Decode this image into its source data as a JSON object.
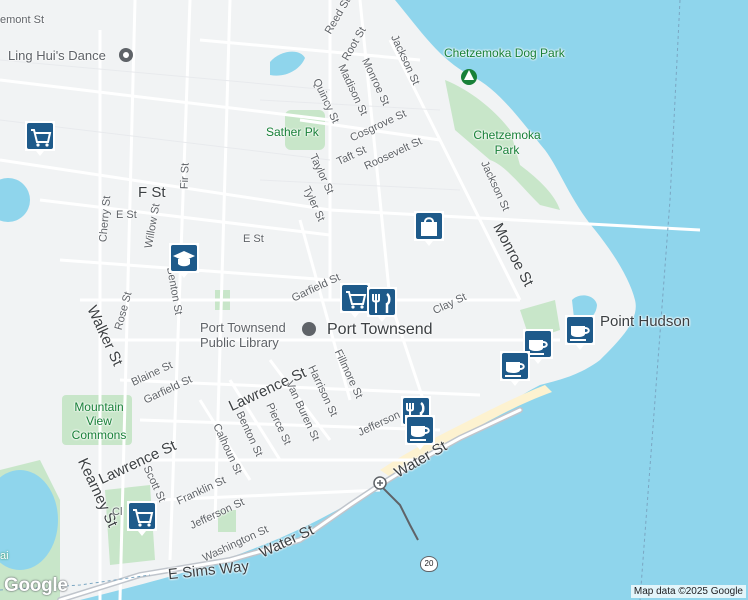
{
  "map": {
    "place_title": "Port Townsend",
    "library_label": "Port Townsend Public Library",
    "pois": {
      "dance": "Ling Hui's Dance",
      "dog_park": "Chetzemoka Dog Park",
      "chetzemoka_park": "Chetzemoka Park",
      "sather_park": "Sather Pk",
      "mountain_view": "Mountain View Commons",
      "point_hudson": "Point Hudson"
    },
    "streets": {
      "reed": "Reed St",
      "root": "Root St",
      "jackson_top": "Jackson St",
      "monroe_top": "Monroe St",
      "madison": "Madison St",
      "quincy": "Quincy St",
      "cosgrove": "Cosgrove St",
      "taft": "Taft St",
      "roosevelt": "Roosevelt St",
      "taylor": "Taylor St",
      "tyler": "Tyler St",
      "jackson_mid": "Jackson St",
      "f": "F St",
      "e_left": "E St",
      "e_mid": "E St",
      "fir": "Fir St",
      "cherry": "Cherry St",
      "willow": "Willow St",
      "benton_top": "Benton St",
      "rose": "Rose St",
      "walker": "Walker St",
      "garfield_top": "Garfield St",
      "monroe_mid": "Monroe St",
      "clay": "Clay St",
      "blaine": "Blaine St",
      "garfield_left": "Garfield St",
      "lawrence_mid": "Lawrence St",
      "van_buren": "Van Buren St",
      "harrison": "Harrison St",
      "fillmore": "Fillmore St",
      "jefferson_mid": "Jefferson St",
      "pierce": "Pierce St",
      "benton_low": "Benton St",
      "calhoun": "Calhoun St",
      "lawrence_left": "Lawrence St",
      "kearney": "Kearney St",
      "scott": "Scott St",
      "franklin": "Franklin St",
      "jefferson_low": "Jefferson St",
      "washington": "Washington St",
      "water_low": "Water St",
      "water_mid": "Water St",
      "sims": "E Sims Way",
      "cla": "Cl",
      "lemont": "emont St"
    },
    "route_shield": "20",
    "credit": "Map data ©2025 Google",
    "logo": "Google",
    "edge_letters": "ai",
    "colors": {
      "water": "#8fd5ec",
      "land": "#f1f3f4",
      "park": "#c8e6c9",
      "road": "#ffffff",
      "highway": "#c0c5cc",
      "marker": "#1e5a8a",
      "beach": "#fdf2d0"
    },
    "markers": [
      {
        "icon": "shopping-cart-icon",
        "name": "marker-shopping-nw"
      },
      {
        "icon": "graduation-cap-icon",
        "name": "marker-school"
      },
      {
        "icon": "shopping-bag-icon",
        "name": "marker-shopping-bag"
      },
      {
        "icon": "shopping-cart-icon",
        "name": "marker-shopping-central"
      },
      {
        "icon": "fork-knife-icon",
        "name": "marker-restaurant-central"
      },
      {
        "icon": "coffee-cup-icon",
        "name": "marker-cafe-east"
      },
      {
        "icon": "coffee-cup-icon",
        "name": "marker-cafe-point-hudson"
      },
      {
        "icon": "coffee-cup-icon",
        "name": "marker-cafe-waterfront"
      },
      {
        "icon": "fork-knife-icon",
        "name": "marker-restaurant-waterfront"
      },
      {
        "icon": "coffee-cup-icon",
        "name": "marker-cafe-south"
      },
      {
        "icon": "shopping-cart-icon",
        "name": "marker-shopping-sw"
      }
    ]
  }
}
